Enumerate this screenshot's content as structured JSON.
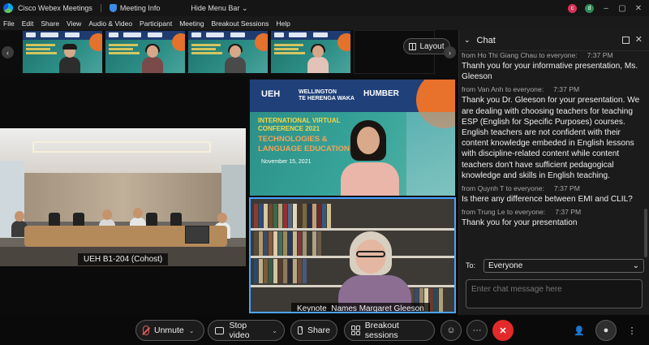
{
  "app": {
    "title": "Cisco Webex Meetings",
    "meeting_info": "Meeting Info",
    "hide_menu": "Hide Menu Bar",
    "hide_menu_caret": "⌄",
    "avatars": [
      "c",
      "d"
    ]
  },
  "menu": [
    "File",
    "Edit",
    "Share",
    "View",
    "Audio & Video",
    "Participant",
    "Meeting",
    "Breakout Sessions",
    "Help"
  ],
  "strip": {
    "layout_label": "Layout",
    "prev_icon": "‹",
    "next_icon": "›"
  },
  "videos": {
    "cohost_label": "UEH B1-204 (Cohost)",
    "speaker_label": "Keynote_Names Margaret Gleeson"
  },
  "slide": {
    "logo_ueh": "UEH",
    "logo_wellington_1": "WELLINGTON",
    "logo_wellington_2": "TE HERENGA WAKA",
    "logo_humber": "HUMBER",
    "conference_line1": "INTERNATIONAL VIRTUAL",
    "conference_line2": "CONFERENCE 2021",
    "theme_line1": "TECHNOLOGIES &",
    "theme_line2": "LANGUAGE EDUCATION",
    "date": "November 15, 2021"
  },
  "chat": {
    "title": "Chat",
    "messages": [
      {
        "meta": "from Ho Thi Giang Chau to everyone:",
        "time": "7:37 PM",
        "text": "Thanh you for your informative presentation, Ms. Gleeson"
      },
      {
        "meta": "from Van Anh to everyone:",
        "time": "7:37 PM",
        "text": "Thank you Dr. Gleeson for your presentation. We are dealing with choosing teachers for teaching ESP (English for Specific Purposes) courses. English teachers are not confident with their content knowledge embeded in English lessons with discipline-related content while content teachers don't have sufficient pedagogical knowledge and skills in English teaching."
      },
      {
        "meta": "from Quynh T to everyone:",
        "time": "7:37 PM",
        "text": "Is there any difference between EMI and CLIL?"
      },
      {
        "meta": "from Trung Le to everyone:",
        "time": "7:37 PM",
        "text": "Thank you for your presentation"
      }
    ],
    "to_label": "To:",
    "to_value": "Everyone",
    "input_placeholder": "Enter chat message here"
  },
  "controls": {
    "unmute": "Unmute",
    "stop_video": "Stop video",
    "share": "Share",
    "breakout": "Breakout sessions",
    "more": "···",
    "end": "✕"
  }
}
